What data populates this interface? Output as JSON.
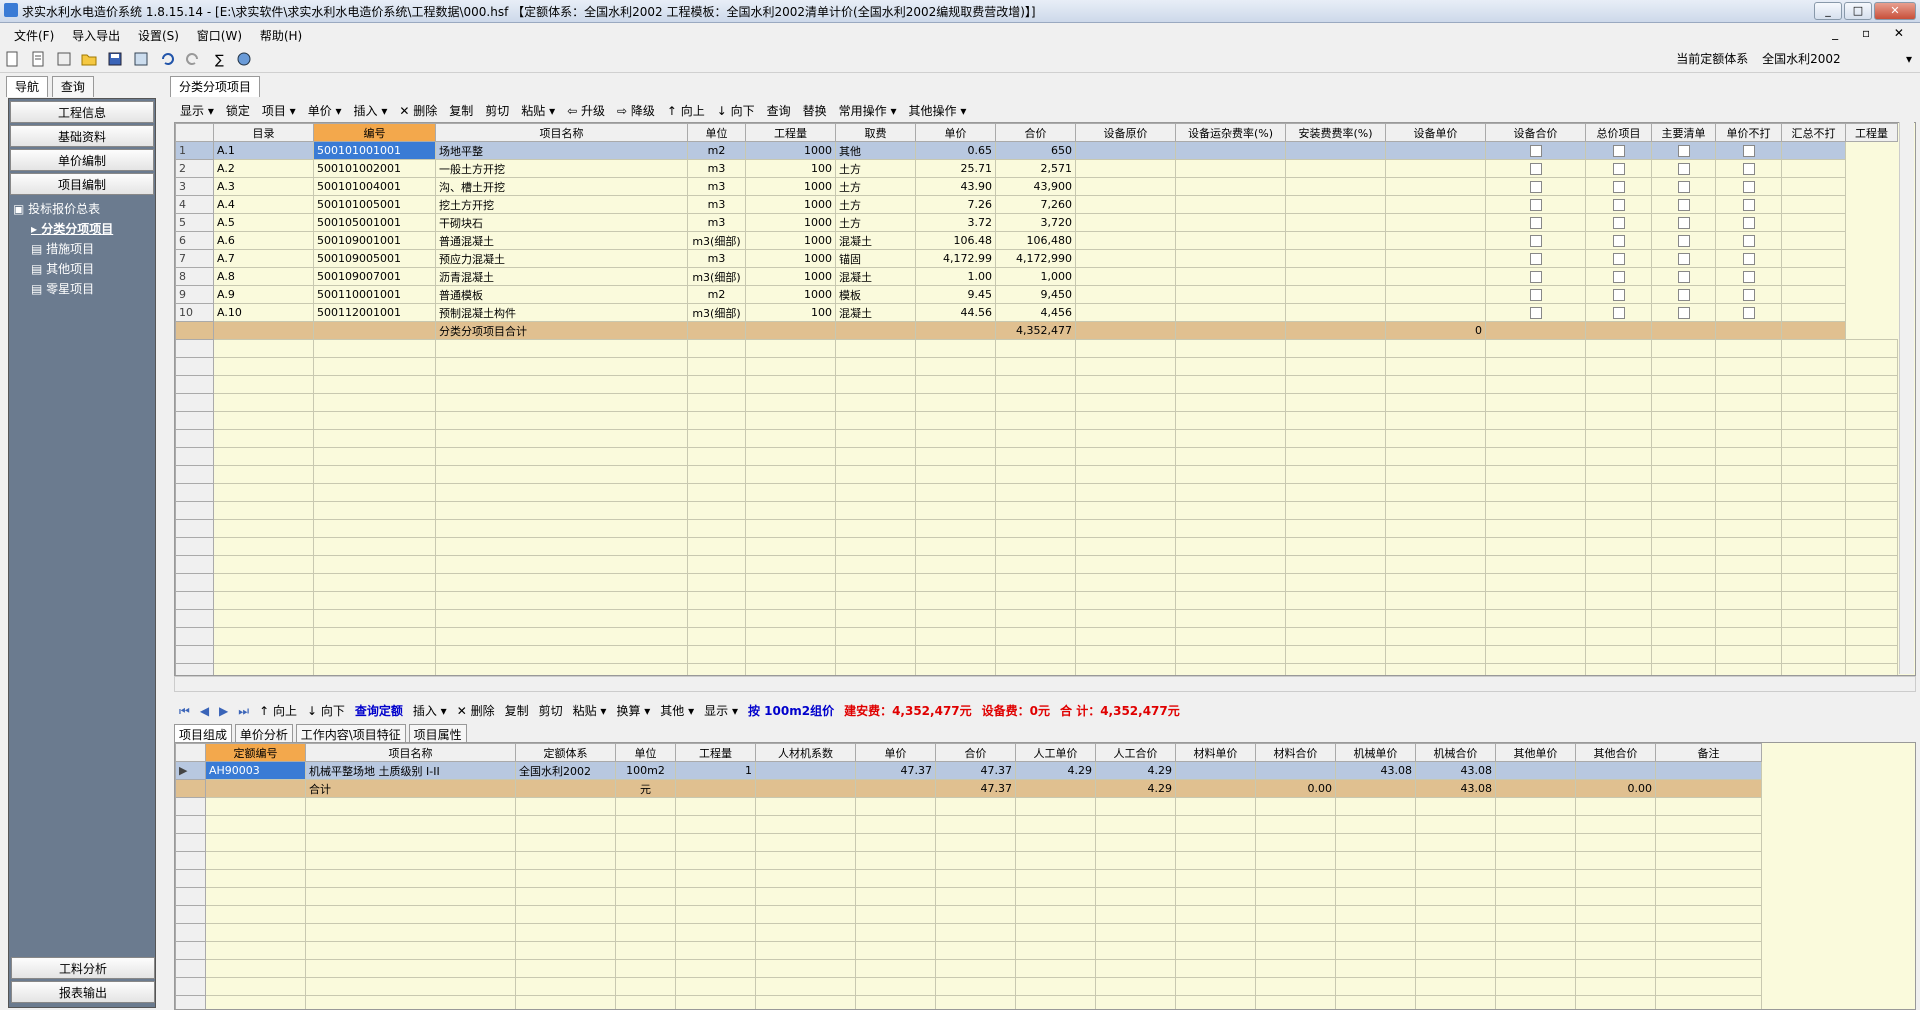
{
  "window": {
    "title": "求实水利水电造价系统 1.8.15.14 - [E:\\求实软件\\求实水利水电造价系统\\工程数据\\000.hsf 【定额体系：全国水利2002  工程模板：全国水利2002清单计价(全国水利2002编规取费营改增)】]",
    "min": "_",
    "max": "□",
    "close": "✕"
  },
  "menu": [
    "文件(F)",
    "导入导出",
    "设置(S)",
    "窗口(W)",
    "帮助(H)"
  ],
  "mdi_buttons": "_ ▫ ✕",
  "quota": {
    "label": "当前定额体系",
    "value": "全国水利2002"
  },
  "nav": {
    "tabs": [
      "导航",
      "查询"
    ],
    "buttons": [
      "工程信息",
      "基础资料",
      "单价编制",
      "项目编制"
    ],
    "tree_root": "投标报价总表",
    "tree_items": [
      "分类分项项目",
      "措施项目",
      "其他项目",
      "零星项目"
    ],
    "bottom_buttons": [
      "工料分析",
      "报表输出"
    ]
  },
  "doc_tab": "分类分项项目",
  "main_toolbar": [
    "显示 ▾",
    "锁定",
    "项目 ▾",
    "单价 ▾",
    "插入 ▾",
    "✕ 删除",
    "复制",
    "剪切",
    "粘贴 ▾",
    "⇦ 升级",
    "⇨ 降级",
    "↑ 向上",
    "↓ 向下",
    "查询",
    "替换",
    "常用操作 ▾",
    "其他操作 ▾"
  ],
  "grid1": {
    "headers": [
      "目录",
      "编号",
      "项目名称",
      "单位",
      "工程量",
      "取费",
      "单价",
      "合价",
      "设备原价",
      "设备运杂费率(%)",
      "安装费费率(%)",
      "设备单价",
      "设备合价",
      "总价项目",
      "主要清单",
      "单价不打",
      "汇总不打",
      "工程量"
    ],
    "rows": [
      {
        "n": "1",
        "dir": "A.1",
        "code": "500101001001",
        "name": "场地平整",
        "unit": "m2",
        "qty": "1000",
        "fee": "其他",
        "price": "0.65",
        "total": "650"
      },
      {
        "n": "2",
        "dir": "A.2",
        "code": "500101002001",
        "name": "一般土方开挖",
        "unit": "m3",
        "qty": "100",
        "fee": "土方",
        "price": "25.71",
        "total": "2,571"
      },
      {
        "n": "3",
        "dir": "A.3",
        "code": "500101004001",
        "name": "沟、槽土开挖",
        "unit": "m3",
        "qty": "1000",
        "fee": "土方",
        "price": "43.90",
        "total": "43,900"
      },
      {
        "n": "4",
        "dir": "A.4",
        "code": "500101005001",
        "name": "挖土方开挖",
        "unit": "m3",
        "qty": "1000",
        "fee": "土方",
        "price": "7.26",
        "total": "7,260"
      },
      {
        "n": "5",
        "dir": "A.5",
        "code": "500105001001",
        "name": "干砌块石",
        "unit": "m3",
        "qty": "1000",
        "fee": "土方",
        "price": "3.72",
        "total": "3,720"
      },
      {
        "n": "6",
        "dir": "A.6",
        "code": "500109001001",
        "name": "普通混凝土",
        "unit": "m3(细部)",
        "qty": "1000",
        "fee": "混凝土",
        "price": "106.48",
        "total": "106,480"
      },
      {
        "n": "7",
        "dir": "A.7",
        "code": "500109005001",
        "name": "预应力混凝土",
        "unit": "m3",
        "qty": "1000",
        "fee": "锚固",
        "price": "4,172.99",
        "total": "4,172,990"
      },
      {
        "n": "8",
        "dir": "A.8",
        "code": "500109007001",
        "name": "沥青混凝土",
        "unit": "m3(细部)",
        "qty": "1000",
        "fee": "混凝土",
        "price": "1.00",
        "total": "1,000"
      },
      {
        "n": "9",
        "dir": "A.9",
        "code": "500110001001",
        "name": "普通模板",
        "unit": "m2",
        "qty": "1000",
        "fee": "模板",
        "price": "9.45",
        "total": "9,450"
      },
      {
        "n": "10",
        "dir": "A.10",
        "code": "500112001001",
        "name": "预制混凝土构件",
        "unit": "m3(细部)",
        "qty": "100",
        "fee": "混凝土",
        "price": "44.56",
        "total": "4,456"
      }
    ],
    "sum_label": "分类分项项目合计",
    "sum_total": "4,352,477",
    "sum_equip": "0"
  },
  "bottom_toolbar": {
    "items": [
      "↑ 向上",
      "↓ 向下",
      "查询定额",
      "插入 ▾",
      "✕ 删除",
      "复制",
      "剪切",
      "粘贴 ▾",
      "换算 ▾",
      "其他 ▾",
      "显示 ▾"
    ],
    "group_price": "按 100m2组价",
    "build_fee": "建安费：4,352,477元",
    "equip_fee": "设备费：0元",
    "total_fee": "合  计：4,352,477元"
  },
  "sub_tabs": [
    "项目组成",
    "单价分析",
    "工作内容\\项目特征",
    "项目属性"
  ],
  "grid2": {
    "headers": [
      "定额编号",
      "项目名称",
      "定额体系",
      "单位",
      "工程量",
      "人材机系数",
      "单价",
      "合价",
      "人工单价",
      "人工合价",
      "材料单价",
      "材料合价",
      "机械单价",
      "机械合价",
      "其他单价",
      "其他合价",
      "备注"
    ],
    "row": {
      "code": "AH90003",
      "name": "机械平整场地 土质级别 I-II",
      "system": "全国水利2002",
      "unit": "100m2",
      "qty": "1",
      "price": "47.37",
      "total": "47.37",
      "labor_p": "4.29",
      "labor_t": "4.29",
      "mach_p": "43.08",
      "mach_t": "43.08"
    },
    "sum": {
      "label": "合计",
      "unit": "元",
      "total": "47.37",
      "labor_t": "4.29",
      "mat_t": "0.00",
      "mach_t": "43.08",
      "other_t": "0.00"
    }
  }
}
